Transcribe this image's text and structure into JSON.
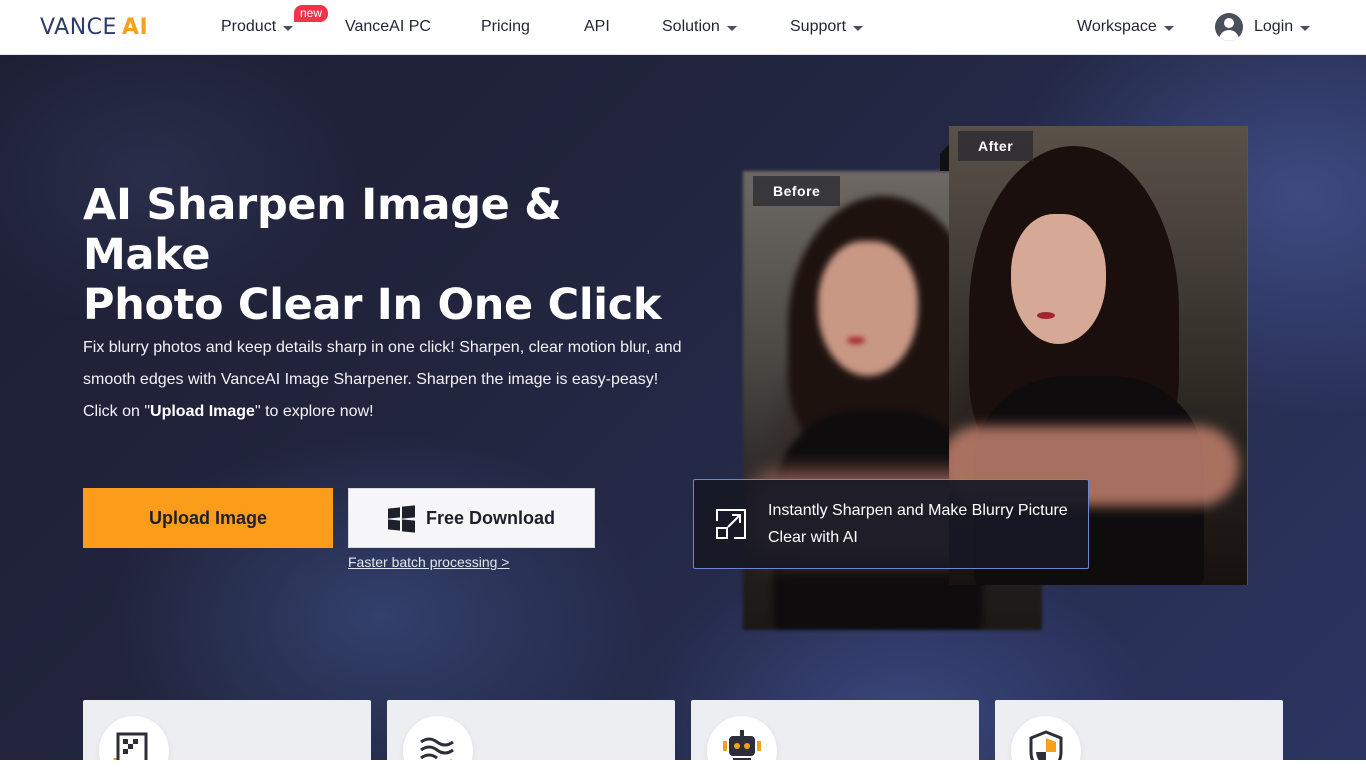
{
  "nav": {
    "logo_text_main": "VANCE",
    "logo_text_accent": "AI",
    "items": [
      {
        "label": "Product",
        "dropdown": true
      },
      {
        "label": "VanceAI PC",
        "dropdown": false
      },
      {
        "label": "Pricing",
        "dropdown": false
      },
      {
        "label": "API",
        "dropdown": false
      },
      {
        "label": "Solution",
        "dropdown": true
      },
      {
        "label": "Support",
        "dropdown": true
      }
    ],
    "new_badge": "new",
    "workspace_label": "Workspace",
    "login_label": "Login",
    "icons": {
      "user": "user-avatar-icon",
      "caret": "chevron-down-icon"
    }
  },
  "hero": {
    "title_line1": "AI Sharpen Image & Make",
    "title_line2": "Photo Clear In One Click",
    "desc_part1": "Fix blurry photos and keep details sharp in one click! Sharpen, clear motion blur, and smooth edges with VanceAI Image Sharpener. Sharpen the image is easy-peasy! Click on \"",
    "desc_bold": "Upload Image",
    "desc_part2": "\" to explore now!",
    "upload_label": "Upload Image",
    "download_label": "Free Download",
    "batch_link": "Faster batch processing >",
    "before_label": "Before",
    "after_label": "After",
    "overlay_text": "Instantly Sharpen and Make Blurry Picture Clear with AI"
  },
  "features": {
    "icons": [
      "pixel-upscale-icon",
      "motion-blur-icon",
      "ai-robot-icon",
      "security-shield-icon"
    ]
  },
  "colors": {
    "accent_orange": "#fb9d1b",
    "brand_navy": "#2e3a6e",
    "new_badge_red": "#f2334a",
    "overlay_border": "#6a86d6"
  }
}
